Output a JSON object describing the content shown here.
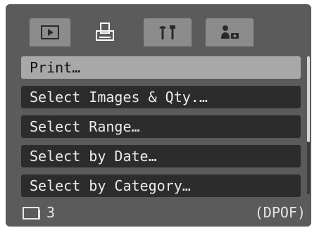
{
  "tabs": [
    {
      "icon": "play-icon",
      "active": false
    },
    {
      "icon": "print-icon",
      "active": true
    },
    {
      "icon": "settings-icon",
      "active": false
    },
    {
      "icon": "my-camera-icon",
      "active": false
    }
  ],
  "menu": {
    "items": [
      {
        "label": "Print…",
        "selected": true
      },
      {
        "label": "Select Images & Qty.…",
        "selected": false
      },
      {
        "label": "Select Range…",
        "selected": false
      },
      {
        "label": "Select by Date…",
        "selected": false
      },
      {
        "label": "Select by Category…",
        "selected": false
      }
    ]
  },
  "status": {
    "copies_icon": "print-copies-icon",
    "count": "3",
    "mode": "(DPOF)"
  },
  "colors": {
    "screen_bg": "#5b5b5b",
    "tab_inactive": "#8c8c8c",
    "item_bg": "#2c2c2c",
    "item_selected": "#a8a8a8",
    "text": "#ececec"
  }
}
